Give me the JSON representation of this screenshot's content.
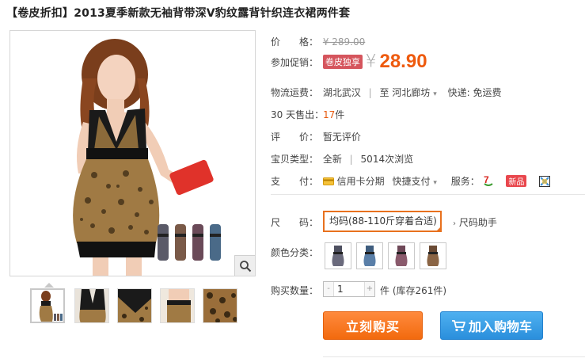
{
  "product": {
    "title": "【卷皮折扣】2013夏季新款无袖背带深V豹纹露背针织连衣裙两件套"
  },
  "price": {
    "label": "价　　格：",
    "original": "¥ 289.00"
  },
  "promo": {
    "label": "参加促销：",
    "tag": "卷皮独享",
    "currency": "¥",
    "value": "28.90"
  },
  "shipping": {
    "label": "物流运费：",
    "from": "湖北武汉",
    "to_prefix": "至",
    "to": "河北廊坊",
    "delivery": "快递: 免运费"
  },
  "sales": {
    "label": "30 天售出：",
    "count": "17",
    "unit": "件"
  },
  "rating": {
    "label": "评　　价：",
    "value": "暂无评价"
  },
  "item_type": {
    "label": "宝贝类型：",
    "condition": "全新",
    "views": "5014次浏览"
  },
  "payment": {
    "label": "支　　付：",
    "installment": "信用卡分期",
    "quick_pay": "快捷支付",
    "service_label": "服务：",
    "new_badge": "新品"
  },
  "size": {
    "label": "尺　　码：",
    "selected": "均码(88-110斤穿着合适)",
    "help": "尺码助手"
  },
  "color": {
    "label": "颜色分类："
  },
  "quantity": {
    "label": "购买数量：",
    "minus": "-",
    "plus": "+",
    "value": "1",
    "unit_stock": "件 (库存261件)"
  },
  "actions": {
    "buy_now": "立刻购买",
    "add_to_cart": "加入购物车"
  },
  "colors": {
    "accent": "#ee5a0e",
    "cart_blue": "#2a8fdc",
    "promo_tag": "#d5555d"
  }
}
